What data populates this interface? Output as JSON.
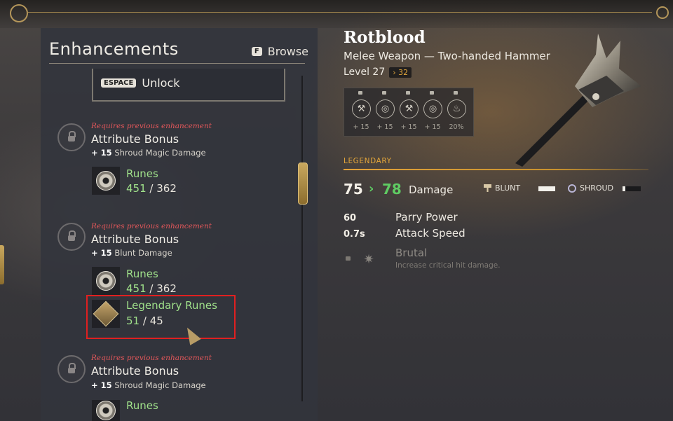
{
  "panel": {
    "title": "Enhancements",
    "browse_key": "F",
    "browse_label": "Browse",
    "unlock_key": "ESPACE",
    "unlock_label": "Unlock"
  },
  "enhancements": [
    {
      "requirement": "Requires previous enhancement",
      "title": "Attribute Bonus",
      "bonus_value": "+ 15",
      "bonus_label": "Shroud Magic Damage",
      "costs": [
        {
          "icon": "rune-icon",
          "name": "Runes",
          "have": "451",
          "need": "/ 362"
        }
      ]
    },
    {
      "requirement": "Requires previous enhancement",
      "title": "Attribute Bonus",
      "bonus_value": "+ 15",
      "bonus_label": "Blunt Damage",
      "costs": [
        {
          "icon": "rune-icon",
          "name": "Runes",
          "have": "451",
          "need": "/ 362"
        },
        {
          "icon": "legendary-rune-icon",
          "name": "Legendary Runes",
          "have": "51",
          "need": "/ 45"
        }
      ]
    },
    {
      "requirement": "Requires previous enhancement",
      "title": "Attribute Bonus",
      "bonus_value": "+ 15",
      "bonus_label": "Shroud Magic Damage",
      "costs": [
        {
          "icon": "rune-icon",
          "name": "Runes",
          "have": "",
          "need": ""
        }
      ]
    }
  ],
  "weapon": {
    "name": "Rotblood",
    "type": "Melee Weapon — Two-handed Hammer",
    "level_label": "Level 27",
    "level_badge": "› 32",
    "slots": [
      {
        "icon": "hammer-icon",
        "value": "+ 15"
      },
      {
        "icon": "shroud-icon",
        "value": "+ 15"
      },
      {
        "icon": "hammer-icon",
        "value": "+ 15"
      },
      {
        "icon": "shroud-icon",
        "value": "+ 15"
      },
      {
        "icon": "flame-icon",
        "value": "20%"
      }
    ],
    "rarity": "LEGENDARY",
    "damage_old": "75",
    "damage_arrow": "›",
    "damage_new": "78",
    "damage_label": "Damage",
    "damage_types": [
      {
        "name": "BLUNT",
        "fill": 1.0
      },
      {
        "name": "SHROUD",
        "fill": 0.15
      }
    ],
    "stats": [
      {
        "value": "60",
        "label": "Parry Power"
      },
      {
        "value": "0.7s",
        "label": "Attack Speed"
      }
    ],
    "perk": {
      "name": "Brutal",
      "description": "Increase critical hit damage."
    }
  },
  "colors": {
    "legendary": "#e4a63a",
    "requirement": "#e2575a",
    "have_enough": "#9fe08a",
    "damage_up": "#5fcc63",
    "highlight": "#e02020"
  }
}
